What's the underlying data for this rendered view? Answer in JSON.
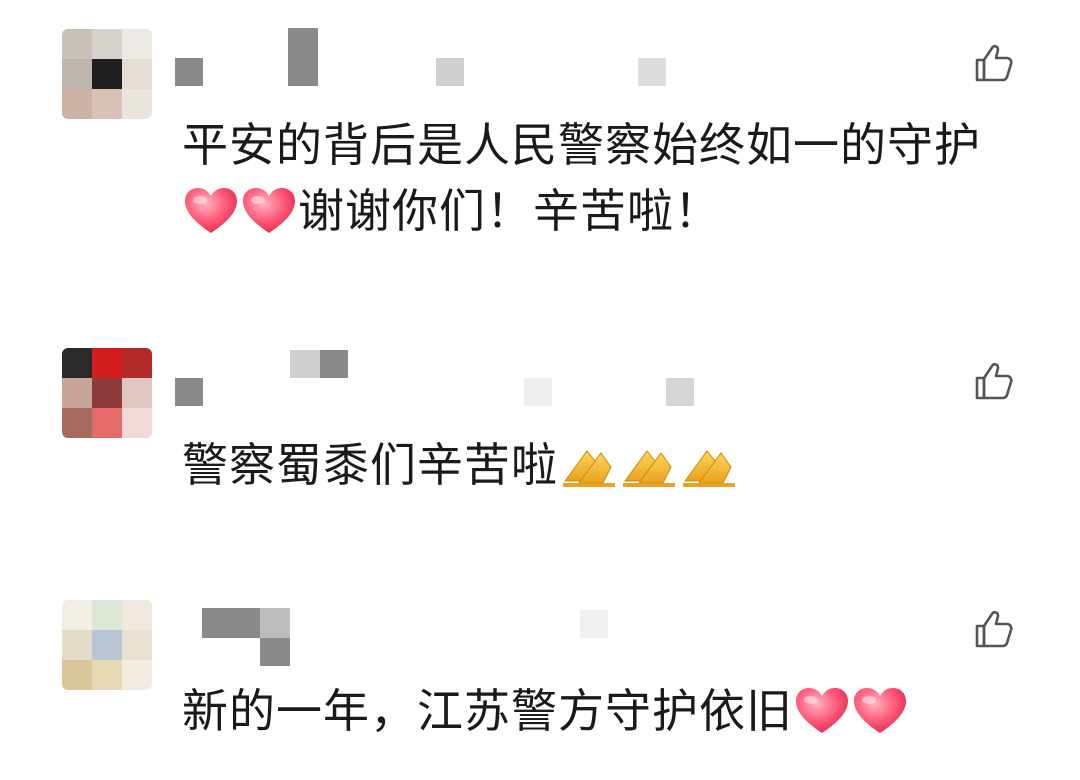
{
  "comments": [
    {
      "text_parts": [
        "平安的背后是人民警察始终如一的守护",
        "谢谢你们！辛苦啦！"
      ],
      "emoji": "heart",
      "emoji_count": 2
    },
    {
      "text_parts": [
        "警察蜀黍们辛苦啦"
      ],
      "emoji": "pray-hands",
      "emoji_count": 3
    },
    {
      "text_parts": [
        "新的一年，江苏警方守护依旧"
      ],
      "emoji": "heart",
      "emoji_count": 2
    }
  ],
  "icons": {
    "like": "thumbs-up-icon",
    "heart": "heart-icon",
    "pray": "pray-hands-icon"
  },
  "colors": {
    "text": "#1a1a1a",
    "icon": "#555555",
    "heart_light": "#ff8fa3",
    "heart_dark": "#e8355a",
    "hands": "#f2b632",
    "mosaic_dark": "#888888",
    "mosaic_light": "#dedede"
  }
}
